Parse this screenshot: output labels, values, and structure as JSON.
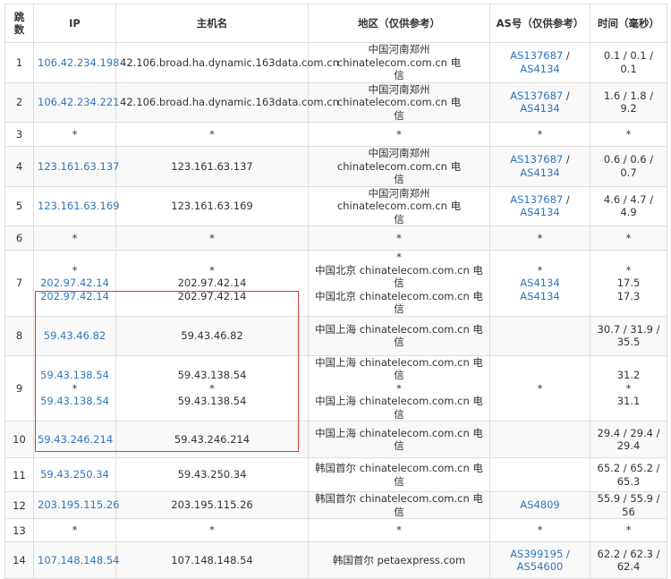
{
  "headers": {
    "hop": [
      "跳",
      "数"
    ],
    "ip": "IP",
    "host": "主机名",
    "region": "地区（仅供参考）",
    "as": "AS号（仅供参考）",
    "time": "时间（毫秒）"
  },
  "rows": [
    {
      "hop": "1",
      "ips": [
        "106.42.234.198"
      ],
      "host": [
        "42.106.broad.ha.dynamic.163data.com.cn"
      ],
      "region": [
        "中国河南郑州 chinatelecom.com.cn 电",
        "信"
      ],
      "as": [
        [
          "AS137687",
          "AS4134"
        ]
      ],
      "time": [
        "0.1 / 0.1 / 0.1"
      ]
    },
    {
      "hop": "2",
      "ips": [
        "106.42.234.221"
      ],
      "host": [
        "42.106.broad.ha.dynamic.163data.com.cn"
      ],
      "region": [
        "中国河南郑州 chinatelecom.com.cn 电",
        "信"
      ],
      "as": [
        [
          "AS137687",
          "AS4134"
        ]
      ],
      "time": [
        "1.6 / 1.8 / 9.2"
      ]
    },
    {
      "hop": "3",
      "ips": [
        "*"
      ],
      "host": [
        "*"
      ],
      "region": [
        "*"
      ],
      "as": [
        [
          "*"
        ]
      ],
      "time": [
        "*"
      ]
    },
    {
      "hop": "4",
      "ips": [
        "123.161.63.137"
      ],
      "host": [
        "123.161.63.137"
      ],
      "region": [
        "中国河南郑州 chinatelecom.com.cn 电",
        "信"
      ],
      "as": [
        [
          "AS137687",
          "AS4134"
        ]
      ],
      "time": [
        "0.6 / 0.6 / 0.7"
      ]
    },
    {
      "hop": "5",
      "ips": [
        "123.161.63.169"
      ],
      "host": [
        "123.161.63.169"
      ],
      "region": [
        "中国河南郑州 chinatelecom.com.cn 电",
        "信"
      ],
      "as": [
        [
          "AS137687",
          "AS4134"
        ]
      ],
      "time": [
        "4.6 / 4.7 / 4.9"
      ]
    },
    {
      "hop": "6",
      "ips": [
        "*"
      ],
      "host": [
        "*"
      ],
      "region": [
        "*"
      ],
      "as": [
        [
          "*"
        ]
      ],
      "time": [
        "*"
      ]
    },
    {
      "hop": "7",
      "ips": [
        "*",
        "202.97.42.14",
        "202.97.42.14"
      ],
      "host": [
        "*",
        "202.97.42.14",
        "202.97.42.14"
      ],
      "region": [
        "*",
        "中国北京 chinatelecom.com.cn 电信",
        "中国北京 chinatelecom.com.cn 电信"
      ],
      "as": [
        [
          "*"
        ],
        [
          "AS4134"
        ],
        [
          "AS4134"
        ]
      ],
      "time": [
        "*",
        "17.5",
        "17.3"
      ]
    },
    {
      "hop": "8",
      "ips": [
        "59.43.46.82"
      ],
      "host": [
        "59.43.46.82"
      ],
      "region": [
        "中国上海 chinatelecom.com.cn 电信"
      ],
      "as": [],
      "time": [
        "30.7 / 31.9 /",
        "35.5"
      ]
    },
    {
      "hop": "9",
      "ips": [
        "59.43.138.54",
        "*",
        "59.43.138.54"
      ],
      "host": [
        "59.43.138.54",
        "*",
        "59.43.138.54"
      ],
      "region": [
        "中国上海 chinatelecom.com.cn 电信",
        "*",
        "中国上海 chinatelecom.com.cn 电信"
      ],
      "as": [
        [
          "*"
        ]
      ],
      "time": [
        "31.2",
        "*",
        "31.1"
      ]
    },
    {
      "hop": "10",
      "ips": [
        "59.43.246.214"
      ],
      "host": [
        "59.43.246.214"
      ],
      "region": [
        "中国上海 chinatelecom.com.cn 电信"
      ],
      "as": [],
      "time": [
        "29.4 / 29.4 /",
        "29.4"
      ]
    },
    {
      "hop": "11",
      "ips": [
        "59.43.250.34"
      ],
      "host": [
        "59.43.250.34"
      ],
      "region": [
        "韩国首尔 chinatelecom.com.cn 电信"
      ],
      "as": [],
      "time": [
        "65.2 / 65.2 /",
        "65.3"
      ]
    },
    {
      "hop": "12",
      "ips": [
        "203.195.115.26"
      ],
      "host": [
        "203.195.115.26"
      ],
      "region": [
        "韩国首尔 chinatelecom.com.cn 电信"
      ],
      "as": [
        [
          "AS4809"
        ]
      ],
      "time": [
        "55.9 / 55.9 / 56"
      ]
    },
    {
      "hop": "13",
      "ips": [
        "*"
      ],
      "host": [
        "*"
      ],
      "region": [
        "*"
      ],
      "as": [
        [
          "*"
        ]
      ],
      "time": [
        "*"
      ]
    },
    {
      "hop": "14",
      "ips": [
        "107.148.148.54"
      ],
      "host": [
        "107.148.148.54"
      ],
      "region": [
        "韩国首尔 petaexpress.com"
      ],
      "as": [
        [
          "AS399195 /"
        ],
        [
          "AS54600"
        ]
      ],
      "time": [
        "62.2 / 62.3 /",
        "62.4"
      ]
    }
  ],
  "colors": {
    "link": "#2e77bd",
    "highlight": "#e03a3a",
    "border": "#dddddd",
    "stripe": "#f9f9f9"
  }
}
